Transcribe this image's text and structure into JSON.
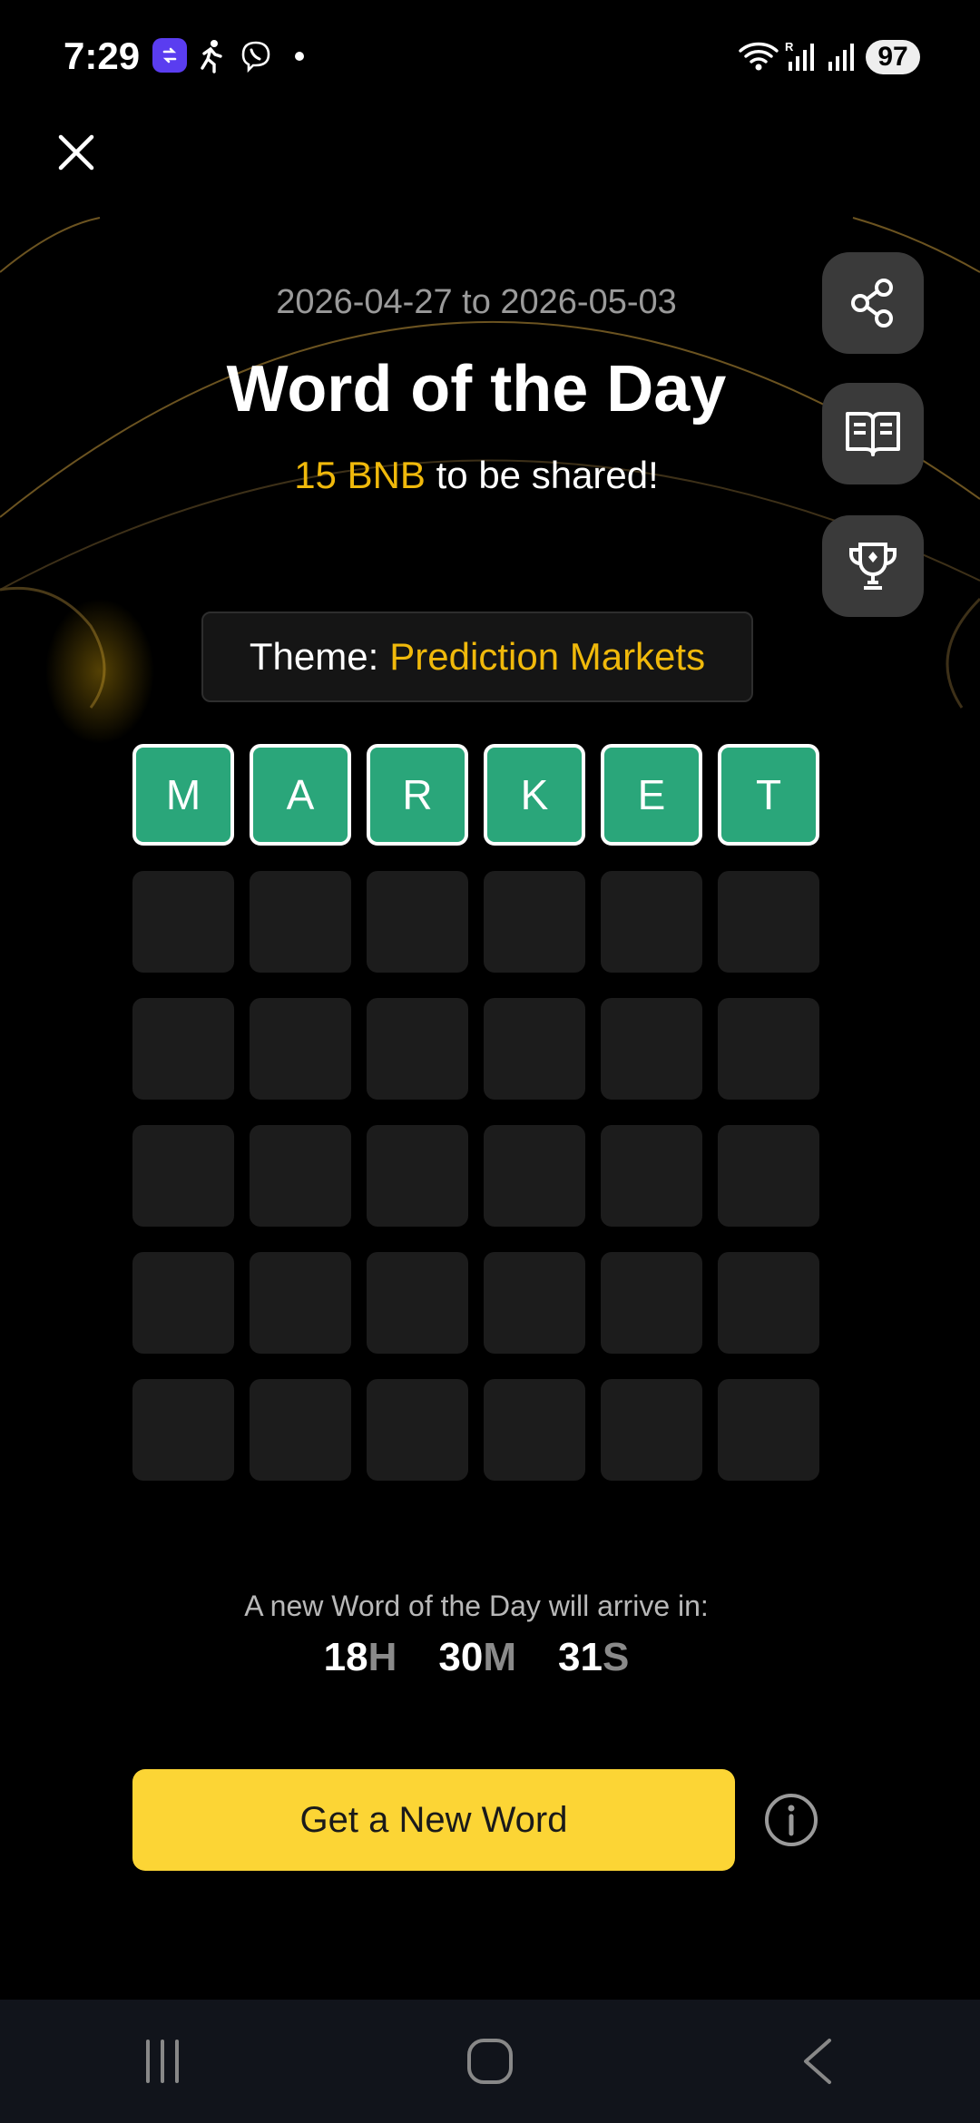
{
  "status_bar": {
    "time": "7:29",
    "battery": "97",
    "icons": [
      "app-badge-icon",
      "running-icon",
      "viber-icon",
      "dot-icon",
      "wifi-icon",
      "roaming-signal-icon",
      "signal-icon"
    ]
  },
  "header": {
    "close_icon": "close-icon",
    "date_range": "2026-04-27 to 2026-05-03",
    "title": "Word of the Day",
    "prize_amount": "15 BNB",
    "prize_suffix": " to be shared!"
  },
  "side_actions": [
    {
      "icon": "share-icon"
    },
    {
      "icon": "book-icon"
    },
    {
      "icon": "trophy-icon"
    }
  ],
  "theme": {
    "label": "Theme:",
    "value": "Prediction Markets"
  },
  "board": {
    "rows": [
      [
        "M",
        "A",
        "R",
        "K",
        "E",
        "T"
      ],
      [
        "",
        "",
        "",
        "",
        "",
        ""
      ],
      [
        "",
        "",
        "",
        "",
        "",
        ""
      ],
      [
        "",
        "",
        "",
        "",
        "",
        ""
      ],
      [
        "",
        "",
        "",
        "",
        "",
        ""
      ],
      [
        "",
        "",
        "",
        "",
        "",
        ""
      ]
    ]
  },
  "countdown": {
    "caption": "A new Word of the Day will arrive in:",
    "hours": "18",
    "hours_unit": "H",
    "minutes": "30",
    "minutes_unit": "M",
    "seconds": "31",
    "seconds_unit": "S"
  },
  "cta": {
    "label": "Get a New Word",
    "info_icon": "info-icon"
  },
  "colors": {
    "accent": "#f0b90b",
    "cta_bg": "#fcd535",
    "tile_correct": "#2aa67a",
    "tile_empty": "#1c1c1c"
  },
  "nav": {
    "icons": [
      "recents-icon",
      "home-icon",
      "back-icon"
    ]
  }
}
